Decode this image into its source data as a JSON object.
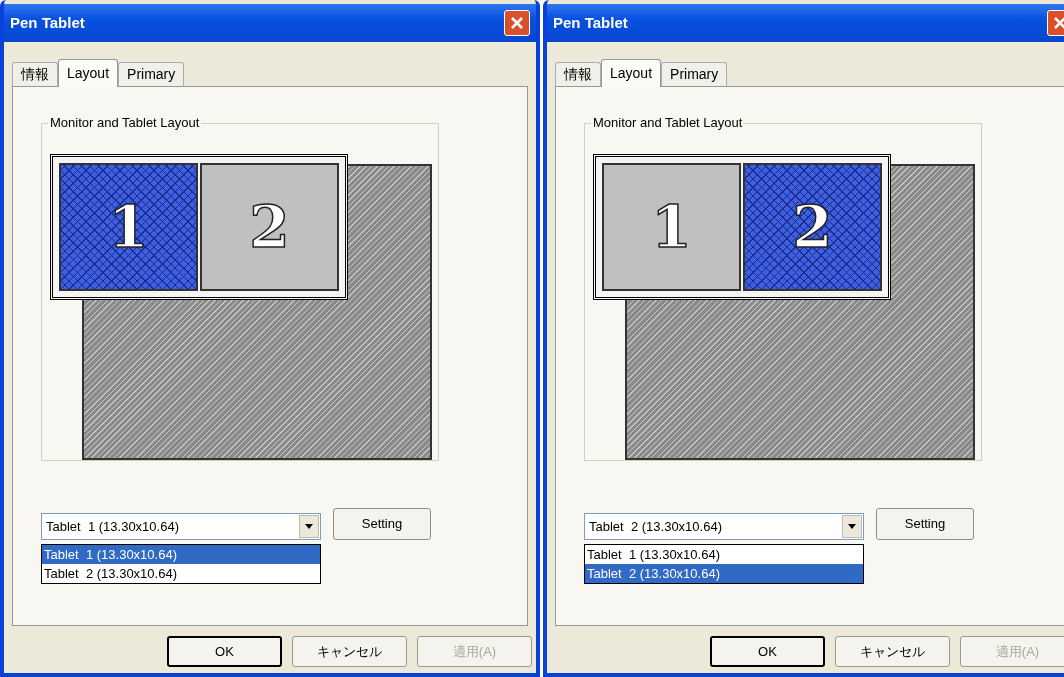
{
  "dialogs": [
    {
      "title": "Pen Tablet",
      "tabs": [
        {
          "label": "情報",
          "selected": false
        },
        {
          "label": "Layout",
          "selected": true
        },
        {
          "label": "Primary",
          "selected": false
        }
      ],
      "group_label": "Monitor and Tablet Layout",
      "monitors": [
        {
          "label": "1",
          "selected": true
        },
        {
          "label": "2",
          "selected": false
        }
      ],
      "tablet_combo": {
        "value": "Tablet  1 (13.30x10.64)"
      },
      "tablet_options": [
        {
          "label": "Tablet  1 (13.30x10.64)",
          "selected": true
        },
        {
          "label": "Tablet  2 (13.30x10.64)",
          "selected": false
        }
      ],
      "setting_button": "Setting",
      "buttons": [
        {
          "label": "OK",
          "default": true,
          "disabled": false
        },
        {
          "label": "キャンセル",
          "default": false,
          "disabled": false
        },
        {
          "label": "適用(A)",
          "default": false,
          "disabled": true
        }
      ]
    },
    {
      "title": "Pen Tablet",
      "tabs": [
        {
          "label": "情報",
          "selected": false
        },
        {
          "label": "Layout",
          "selected": true
        },
        {
          "label": "Primary",
          "selected": false
        }
      ],
      "group_label": "Monitor and Tablet Layout",
      "monitors": [
        {
          "label": "1",
          "selected": false
        },
        {
          "label": "2",
          "selected": true
        }
      ],
      "tablet_combo": {
        "value": "Tablet  2 (13.30x10.64)"
      },
      "tablet_options": [
        {
          "label": "Tablet  1 (13.30x10.64)",
          "selected": false
        },
        {
          "label": "Tablet  2 (13.30x10.64)",
          "selected": true
        }
      ],
      "setting_button": "Setting",
      "buttons": [
        {
          "label": "OK",
          "default": true,
          "disabled": false
        },
        {
          "label": "キャンセル",
          "default": false,
          "disabled": false
        },
        {
          "label": "適用(A)",
          "default": false,
          "disabled": true
        }
      ]
    }
  ]
}
